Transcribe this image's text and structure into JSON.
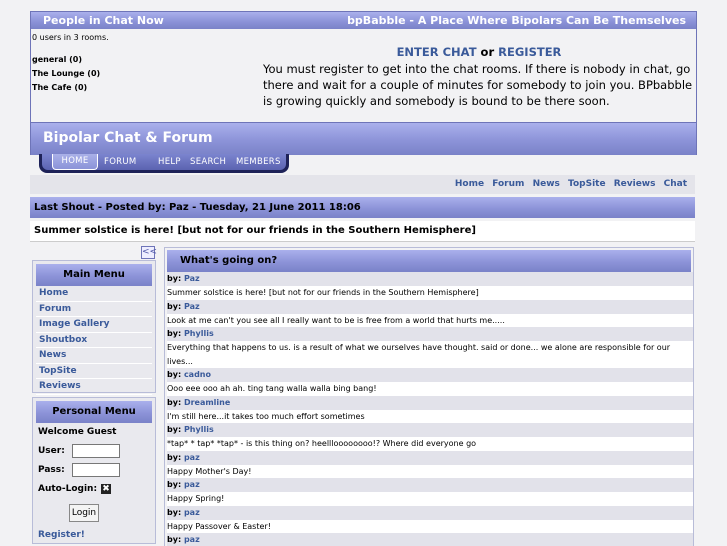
{
  "chat": {
    "left_title": "People in Chat Now",
    "right_title": "bpBabble - A Place Where Bipolars Can Be Themselves",
    "users_text": "0 users in 3 rooms.",
    "rooms": [
      "general (0)",
      "The Lounge (0)",
      "The Cafe (0)"
    ],
    "enter_link": "ENTER CHAT",
    "or_text": " or ",
    "register_link": "REGISTER",
    "message": "You must register to get into the chat rooms. If there is nobody in chat, go there and wait for a couple of minutes for somebody to join you. BPbabble is growing quickly and somebody is bound to be there soon."
  },
  "header": {
    "title": "Bipolar Chat & Forum",
    "nav": [
      "HOME",
      "FORUM",
      "HELP",
      "SEARCH",
      "MEMBERS"
    ]
  },
  "sublinks": [
    "Home",
    "Forum",
    "News",
    "TopSite",
    "Reviews",
    "Chat"
  ],
  "shout": {
    "title": "Last Shout - Posted by: Paz - Tuesday, 21 June 2011 18:06",
    "message": "Summer solstice is here! [but not for our friends in the Southern Hemisphere]"
  },
  "collapse_label": "<<",
  "main_menu": {
    "title": "Main Menu",
    "items": [
      "Home",
      "Forum",
      "Image Gallery",
      "Shoutbox",
      "News",
      "TopSite",
      "Reviews"
    ]
  },
  "personal_menu": {
    "title": "Personal Menu",
    "welcome": "Welcome Guest",
    "user_label": "User:",
    "pass_label": "Pass:",
    "autologin_label": "Auto-Login:",
    "autologin_mark": "✖",
    "login_button": "Login",
    "register_link": "Register!"
  },
  "whats_going_on": {
    "title": "What's going on?",
    "by_prefix": "by: ",
    "entries": [
      {
        "author": "Paz",
        "message": "Summer solstice is here! [but not for our friends in the Southern Hemisphere]"
      },
      {
        "author": "Paz",
        "message": "Look at me can't you see all I really want to be is free from a world that hurts me....."
      },
      {
        "author": "Phyllis",
        "message": "Everything that happens to us. is a result of what we ourselves have thought. said or done... we alone are responsible for our lives..."
      },
      {
        "author": "cadno",
        "message": "Ooo eee ooo ah ah. ting tang walla walla bing bang!"
      },
      {
        "author": "Dreamline",
        "message": "I'm still here...it takes too much effort sometimes"
      },
      {
        "author": "Phyllis",
        "message": "*tap* * tap* *tap* - is this thing on? heellloooooooo!? Where did everyone go"
      },
      {
        "author": "paz",
        "message": "Happy Mother's Day!"
      },
      {
        "author": "paz",
        "message": "Happy Spring!"
      },
      {
        "author": "paz",
        "message": "Happy Passover & Easter!"
      },
      {
        "author": "paz",
        "message": ""
      }
    ]
  }
}
